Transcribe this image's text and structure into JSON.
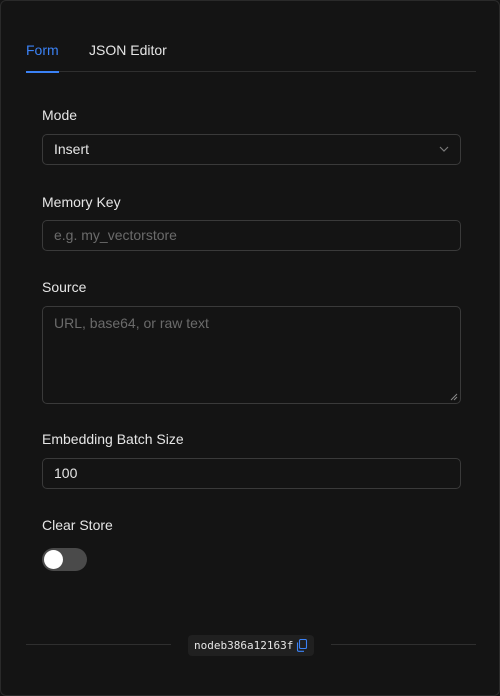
{
  "tabs": [
    {
      "label": "Form",
      "active": true
    },
    {
      "label": "JSON Editor",
      "active": false
    }
  ],
  "fields": {
    "mode": {
      "label": "Mode",
      "value": "Insert"
    },
    "memory_key": {
      "label": "Memory Key",
      "value": "",
      "placeholder": "e.g. my_vectorstore"
    },
    "source": {
      "label": "Source",
      "value": "",
      "placeholder": "URL, base64, or raw text"
    },
    "embedding_batch_size": {
      "label": "Embedding Batch Size",
      "value": "100"
    },
    "clear_store": {
      "label": "Clear Store",
      "enabled": false
    }
  },
  "footer": {
    "node_id": "nodeb386a12163f",
    "copy_icon": "copy-icon"
  },
  "colors": {
    "accent": "#3b82f6",
    "background": "#141414",
    "border": "#3a3a3a",
    "placeholder": "#6b6b6b"
  }
}
